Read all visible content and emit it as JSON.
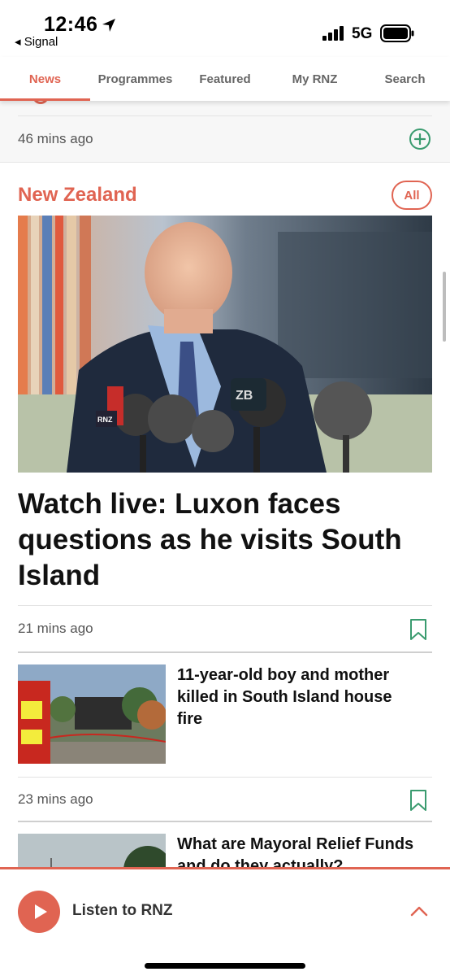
{
  "status_bar": {
    "time": "12:46",
    "back_app": "◂ Signal",
    "network": "5G"
  },
  "tabs": [
    {
      "label": "News",
      "active": true
    },
    {
      "label": "Programmes",
      "active": false
    },
    {
      "label": "Featured",
      "active": false
    },
    {
      "label": "My RNZ",
      "active": false
    },
    {
      "label": "Search",
      "active": false
    }
  ],
  "top_item": {
    "time": "46 mins ago",
    "action_icon": "plus-circle-icon"
  },
  "section": {
    "title": "New Zealand",
    "all_label": "All"
  },
  "hero": {
    "title": "Watch live: Luxon faces questions as he visits South Island",
    "time": "21 mins ago",
    "image_icon": "press-conference-photo"
  },
  "stories": [
    {
      "title": "11-year-old boy and mother killed in South Island house fire",
      "time": "23 mins ago"
    },
    {
      "title": "What are Mayoral Relief Funds and do they actually?"
    }
  ],
  "player": {
    "label": "Listen to RNZ"
  },
  "colors": {
    "accent": "#e06452",
    "green": "#3a9b6f"
  }
}
